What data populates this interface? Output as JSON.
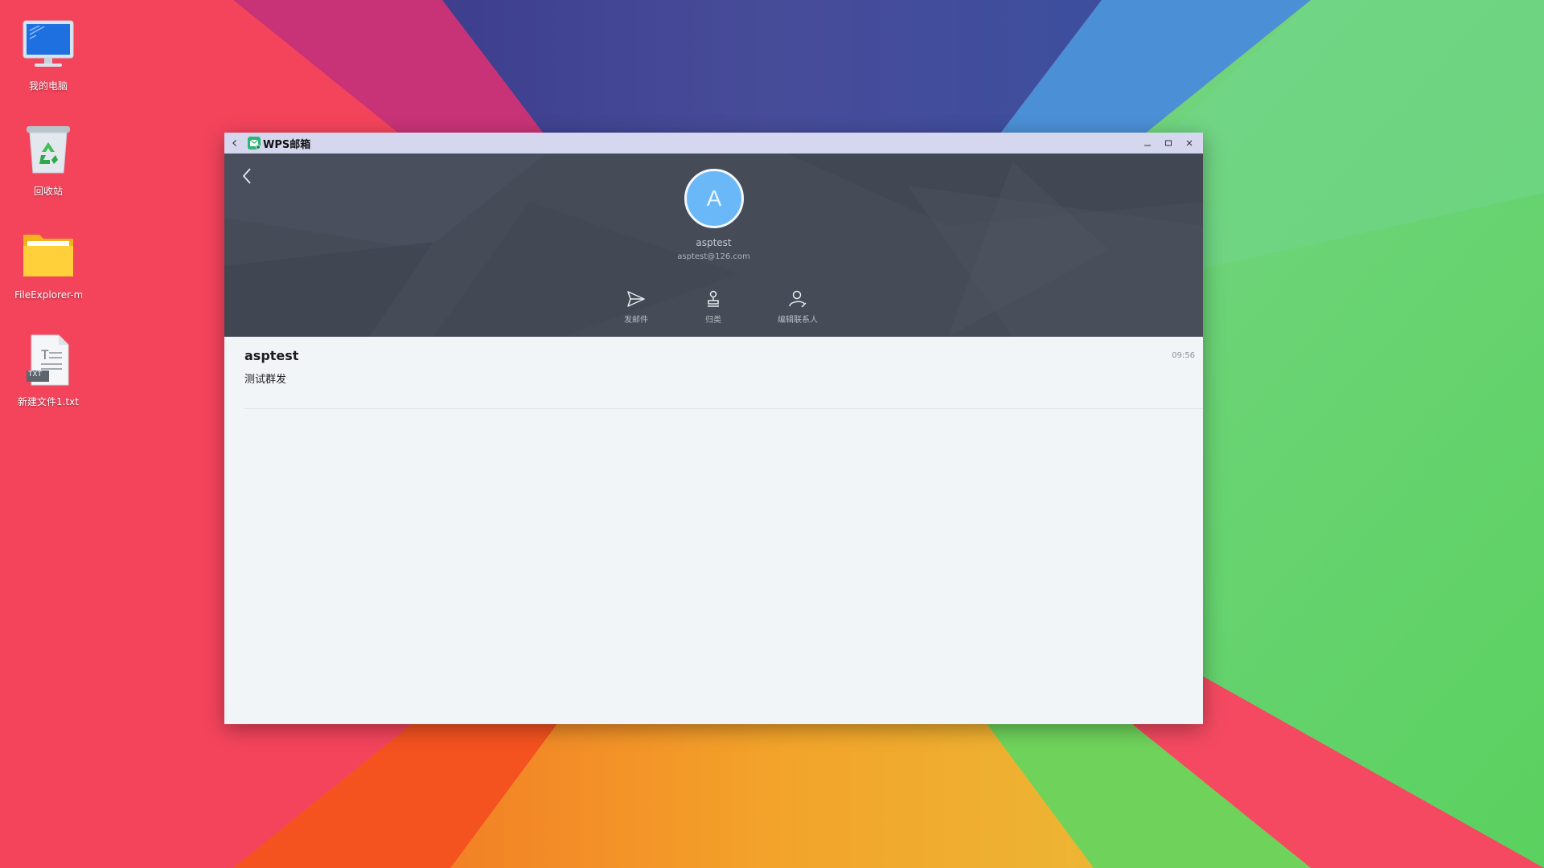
{
  "desktop": {
    "icons": [
      {
        "label": "我的电脑",
        "icon": "computer-icon"
      },
      {
        "label": "回收站",
        "icon": "recycle-bin-icon"
      },
      {
        "label": "FileExplorer-m",
        "icon": "folder-icon"
      },
      {
        "label": "新建文件1.txt",
        "icon": "txt-file-icon",
        "badge": "TXT"
      }
    ]
  },
  "window": {
    "title": "WPS邮箱",
    "controls": [
      "minimize",
      "maximize",
      "close"
    ]
  },
  "contact": {
    "avatar_letter": "A",
    "name": "asptest",
    "email": "asptest@126.com",
    "actions": [
      {
        "label": "发邮件",
        "icon": "send-icon"
      },
      {
        "label": "归类",
        "icon": "stamp-icon"
      },
      {
        "label": "编辑联系人",
        "icon": "edit-contact-icon"
      }
    ]
  },
  "mails": [
    {
      "sender": "asptest",
      "subject": "测试群发",
      "time": "09:56"
    }
  ],
  "colors": {
    "titlebar": "#d5d7ee",
    "header_bg": "#454b57",
    "avatar": "#6ab8f7",
    "list_bg": "#f2f5f8"
  }
}
